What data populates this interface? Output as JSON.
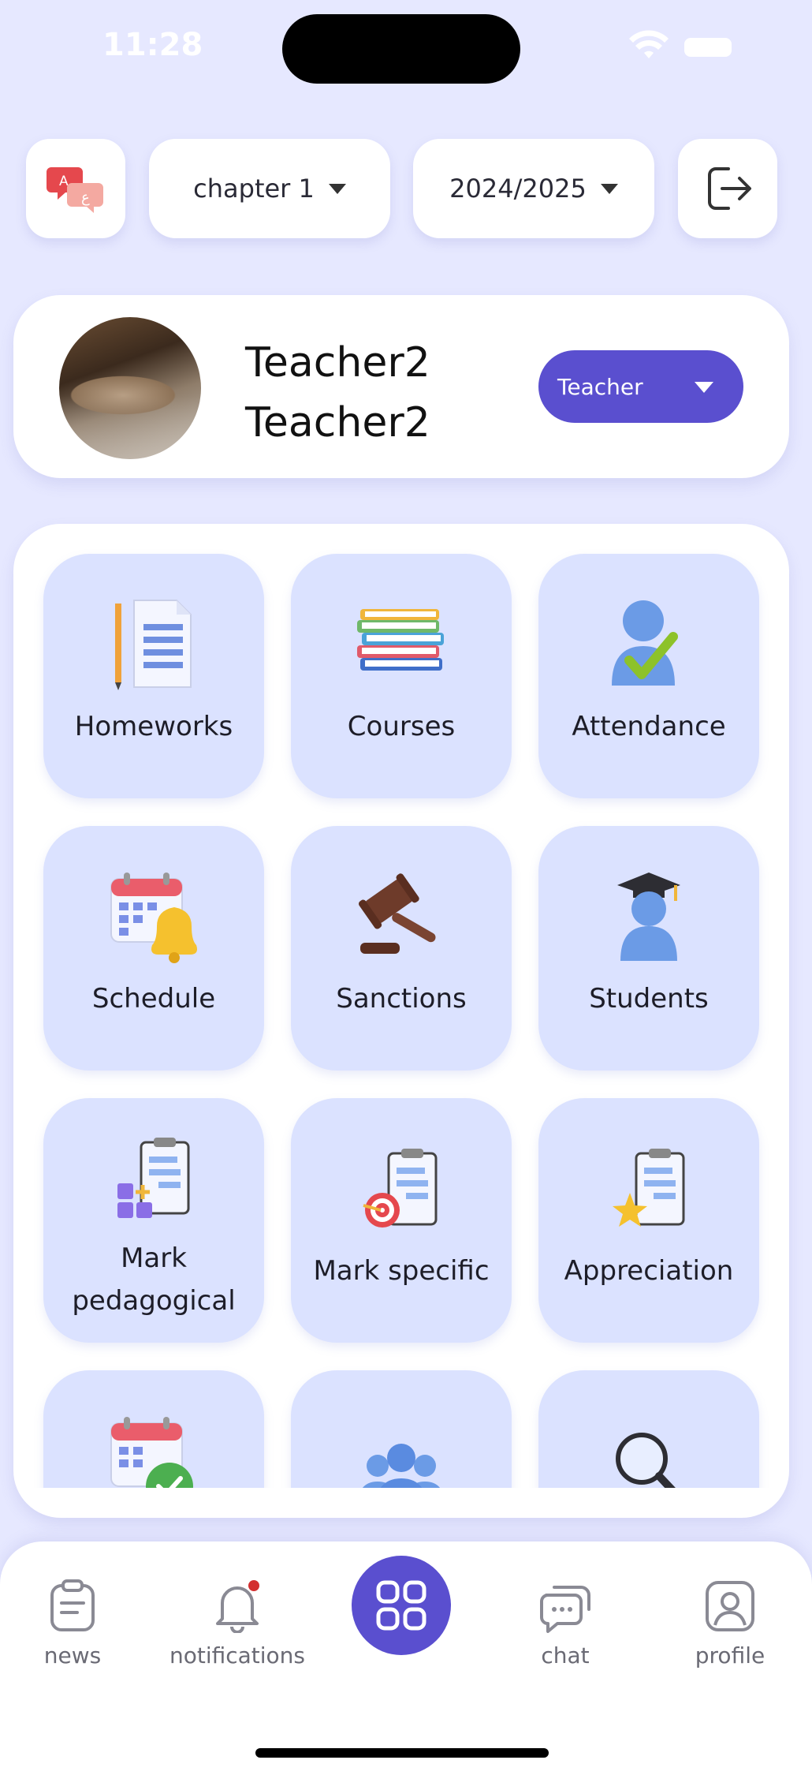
{
  "status_bar": {
    "time": "11:28"
  },
  "top_bar": {
    "chapter_select": {
      "value": "chapter 1"
    },
    "year_select": {
      "value": "2024/2025"
    }
  },
  "profile": {
    "first_name": "Teacher2",
    "last_name": "Teacher2",
    "role_select": {
      "value": "Teacher"
    }
  },
  "menu": {
    "items": [
      {
        "label": "Homeworks",
        "icon": "homework-icon"
      },
      {
        "label": "Courses",
        "icon": "books-icon"
      },
      {
        "label": "Attendance",
        "icon": "attendance-icon"
      },
      {
        "label": "Schedule",
        "icon": "calendar-bell-icon"
      },
      {
        "label": "Sanctions",
        "icon": "gavel-icon"
      },
      {
        "label": "Students",
        "icon": "graduate-icon"
      },
      {
        "label": "Mark pedagogical",
        "label_line1": "Mark",
        "label_line2": "pedagogical",
        "icon": "clipboard-blocks-icon"
      },
      {
        "label": "Mark specific",
        "icon": "clipboard-target-icon"
      },
      {
        "label": "Appreciation",
        "icon": "clipboard-star-icon"
      },
      {
        "label": "",
        "icon": "calendar-check-icon"
      },
      {
        "label": "",
        "icon": "group-icon"
      },
      {
        "label": "",
        "icon": "magnifier-icon"
      }
    ]
  },
  "bottom_nav": {
    "items": [
      {
        "label": "news",
        "icon": "clipboard-icon"
      },
      {
        "label": "notifications",
        "icon": "bell-icon",
        "has_badge": true
      },
      {
        "label": "",
        "icon": "grid-icon",
        "active": true
      },
      {
        "label": "chat",
        "icon": "chat-icon"
      },
      {
        "label": "profile",
        "icon": "user-icon"
      }
    ]
  },
  "colors": {
    "background": "#e6e8ff",
    "accent": "#5a4fcf",
    "tile": "#dbe2ff",
    "badge": "#d32f2f"
  }
}
